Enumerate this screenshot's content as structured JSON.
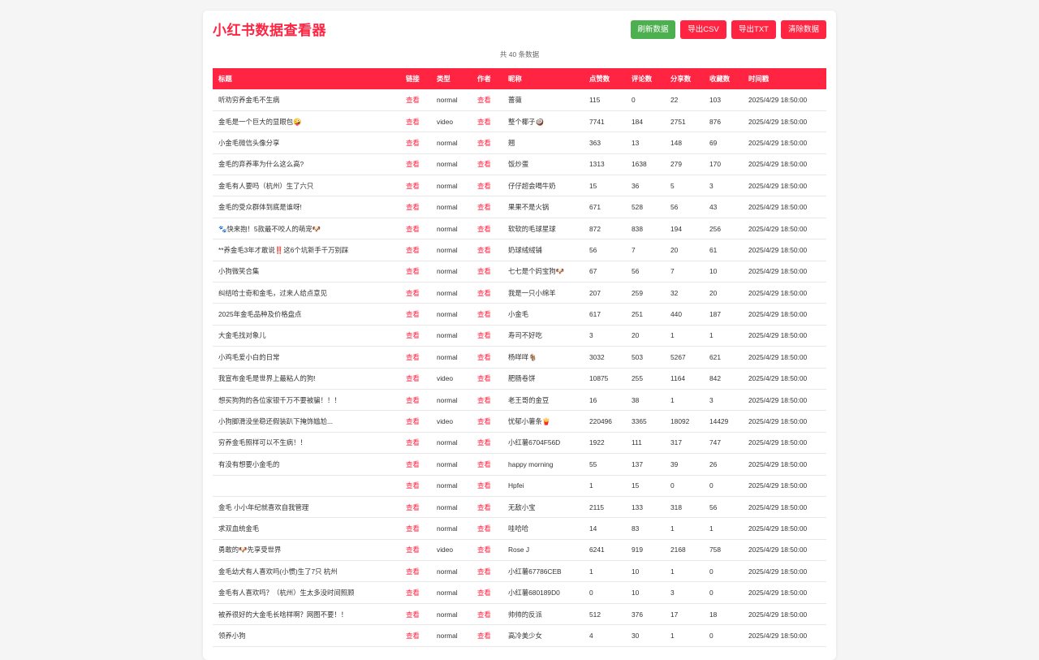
{
  "app": {
    "title": "小红书数据查看器",
    "count_text": "共 40 条数据"
  },
  "toolbar": {
    "refresh_label": "刷新数据",
    "export_csv_label": "导出CSV",
    "export_txt_label": "导出TXT",
    "clear_label": "清除数据"
  },
  "colors": {
    "brand": "#ff2442",
    "refresh_button": "#4caf50"
  },
  "table": {
    "headers": [
      "标题",
      "链接",
      "类型",
      "作者",
      "昵称",
      "点赞数",
      "评论数",
      "分享数",
      "收藏数",
      "时间戳"
    ],
    "rows": [
      {
        "title": "听劝穷养金毛不生病",
        "link": "查看",
        "type": "normal",
        "author": "查看",
        "nickname": "蔷薇",
        "likes": "115",
        "comments": "0",
        "shares": "22",
        "collects": "103",
        "time": "2025/4/29 18:50:00"
      },
      {
        "title": "金毛是一个巨大的显眼包🤪",
        "link": "查看",
        "type": "video",
        "author": "查看",
        "nickname": "整个椰子🥥",
        "likes": "7741",
        "comments": "184",
        "shares": "2751",
        "collects": "876",
        "time": "2025/4/29 18:50:00"
      },
      {
        "title": "小金毛微信头像分享",
        "link": "查看",
        "type": "normal",
        "author": "查看",
        "nickname": "翘",
        "likes": "363",
        "comments": "13",
        "shares": "148",
        "collects": "69",
        "time": "2025/4/29 18:50:00"
      },
      {
        "title": "金毛的弃养率为什么这么高?",
        "link": "查看",
        "type": "normal",
        "author": "查看",
        "nickname": "饭炒蛋",
        "likes": "1313",
        "comments": "1638",
        "shares": "279",
        "collects": "170",
        "time": "2025/4/29 18:50:00"
      },
      {
        "title": "金毛有人要吗（杭州）生了六只",
        "link": "查看",
        "type": "normal",
        "author": "查看",
        "nickname": "仔仔超会喝牛奶",
        "likes": "15",
        "comments": "36",
        "shares": "5",
        "collects": "3",
        "time": "2025/4/29 18:50:00"
      },
      {
        "title": "金毛的受众群体到底是谁呀!",
        "link": "查看",
        "type": "normal",
        "author": "查看",
        "nickname": "果果不是火锅",
        "likes": "671",
        "comments": "528",
        "shares": "56",
        "collects": "43",
        "time": "2025/4/29 18:50:00"
      },
      {
        "title": "🐾快来抱！5款最不咬人的萌宠🐶",
        "link": "查看",
        "type": "normal",
        "author": "查看",
        "nickname": "软软的毛球星球",
        "likes": "872",
        "comments": "838",
        "shares": "194",
        "collects": "256",
        "time": "2025/4/29 18:50:00"
      },
      {
        "title": "**养金毛3年才敢说‼️这6个坑新手千万别踩",
        "link": "查看",
        "type": "normal",
        "author": "查看",
        "nickname": "奶球绒绒铺",
        "likes": "56",
        "comments": "7",
        "shares": "20",
        "collects": "61",
        "time": "2025/4/29 18:50:00"
      },
      {
        "title": "小狗微笑合集",
        "link": "查看",
        "type": "normal",
        "author": "查看",
        "nickname": "七七是个妈宝狗🐶",
        "likes": "67",
        "comments": "56",
        "shares": "7",
        "collects": "10",
        "time": "2025/4/29 18:50:00"
      },
      {
        "title": "纠结哈士奇和金毛，过来人给点意见",
        "link": "查看",
        "type": "normal",
        "author": "查看",
        "nickname": "我是一只小绵羊",
        "likes": "207",
        "comments": "259",
        "shares": "32",
        "collects": "20",
        "time": "2025/4/29 18:50:00"
      },
      {
        "title": "2025年金毛品种及价格盘点",
        "link": "查看",
        "type": "normal",
        "author": "查看",
        "nickname": "小金毛",
        "likes": "617",
        "comments": "251",
        "shares": "440",
        "collects": "187",
        "time": "2025/4/29 18:50:00"
      },
      {
        "title": "大金毛找对象儿",
        "link": "查看",
        "type": "normal",
        "author": "查看",
        "nickname": "寿司不好吃",
        "likes": "3",
        "comments": "20",
        "shares": "1",
        "collects": "1",
        "time": "2025/4/29 18:50:00"
      },
      {
        "title": "小鸡毛爱小白的日常",
        "link": "查看",
        "type": "normal",
        "author": "查看",
        "nickname": "杨咩咩🐐",
        "likes": "3032",
        "comments": "503",
        "shares": "5267",
        "collects": "621",
        "time": "2025/4/29 18:50:00"
      },
      {
        "title": "我宣布金毛是世界上最粘人的狗!",
        "link": "查看",
        "type": "video",
        "author": "查看",
        "nickname": "肥肠卷饼",
        "likes": "10875",
        "comments": "255",
        "shares": "1164",
        "collects": "842",
        "time": "2025/4/29 18:50:00"
      },
      {
        "title": "想买狗狗的各位家银千万不要被骗！！！",
        "link": "查看",
        "type": "normal",
        "author": "查看",
        "nickname": "老王哥的金豆",
        "likes": "16",
        "comments": "38",
        "shares": "1",
        "collects": "3",
        "time": "2025/4/29 18:50:00"
      },
      {
        "title": "小狗脚滑没坐稳还假装趴下掩饰尴尬...",
        "link": "查看",
        "type": "video",
        "author": "查看",
        "nickname": "忧郁小薯条🍟",
        "likes": "220496",
        "comments": "3365",
        "shares": "18092",
        "collects": "14429",
        "time": "2025/4/29 18:50:00"
      },
      {
        "title": "穷养金毛照样可以不生病！！",
        "link": "查看",
        "type": "normal",
        "author": "查看",
        "nickname": "小红薯6704F56D",
        "likes": "1922",
        "comments": "111",
        "shares": "317",
        "collects": "747",
        "time": "2025/4/29 18:50:00"
      },
      {
        "title": "有没有想要小金毛的",
        "link": "查看",
        "type": "normal",
        "author": "查看",
        "nickname": "happy morning",
        "likes": "55",
        "comments": "137",
        "shares": "39",
        "collects": "26",
        "time": "2025/4/29 18:50:00"
      },
      {
        "title": "",
        "link": "查看",
        "type": "normal",
        "author": "查看",
        "nickname": "Hpfei",
        "likes": "1",
        "comments": "15",
        "shares": "0",
        "collects": "0",
        "time": "2025/4/29 18:50:00"
      },
      {
        "title": "金毛 小小年纪就喜欢自我管理",
        "link": "查看",
        "type": "normal",
        "author": "查看",
        "nickname": "无敌小宝",
        "likes": "2115",
        "comments": "133",
        "shares": "318",
        "collects": "56",
        "time": "2025/4/29 18:50:00"
      },
      {
        "title": "求双血统金毛",
        "link": "查看",
        "type": "normal",
        "author": "查看",
        "nickname": "哇哈哈",
        "likes": "14",
        "comments": "83",
        "shares": "1",
        "collects": "1",
        "time": "2025/4/29 18:50:00"
      },
      {
        "title": "勇敢的🐶先享受世界",
        "link": "查看",
        "type": "video",
        "author": "查看",
        "nickname": "Rose J",
        "likes": "6241",
        "comments": "919",
        "shares": "2168",
        "collects": "758",
        "time": "2025/4/29 18:50:00"
      },
      {
        "title": "金毛幼犬有人喜欢吗(小惯)生了7只 杭州",
        "link": "查看",
        "type": "normal",
        "author": "查看",
        "nickname": "小红薯67786CEB",
        "likes": "1",
        "comments": "10",
        "shares": "1",
        "collects": "0",
        "time": "2025/4/29 18:50:00"
      },
      {
        "title": "金毛有人喜欢吗？（杭州）生太多没时间照顾",
        "link": "查看",
        "type": "normal",
        "author": "查看",
        "nickname": "小红薯680189D0",
        "likes": "0",
        "comments": "10",
        "shares": "3",
        "collects": "0",
        "time": "2025/4/29 18:50:00"
      },
      {
        "title": "被养很好的大金毛长啥样啊？网图不要！！",
        "link": "查看",
        "type": "normal",
        "author": "查看",
        "nickname": "帅帅的反派",
        "likes": "512",
        "comments": "376",
        "shares": "17",
        "collects": "18",
        "time": "2025/4/29 18:50:00"
      },
      {
        "title": "领养小狗",
        "link": "查看",
        "type": "normal",
        "author": "查看",
        "nickname": "高冷美少女",
        "likes": "4",
        "comments": "30",
        "shares": "1",
        "collects": "0",
        "time": "2025/4/29 18:50:00"
      }
    ]
  }
}
